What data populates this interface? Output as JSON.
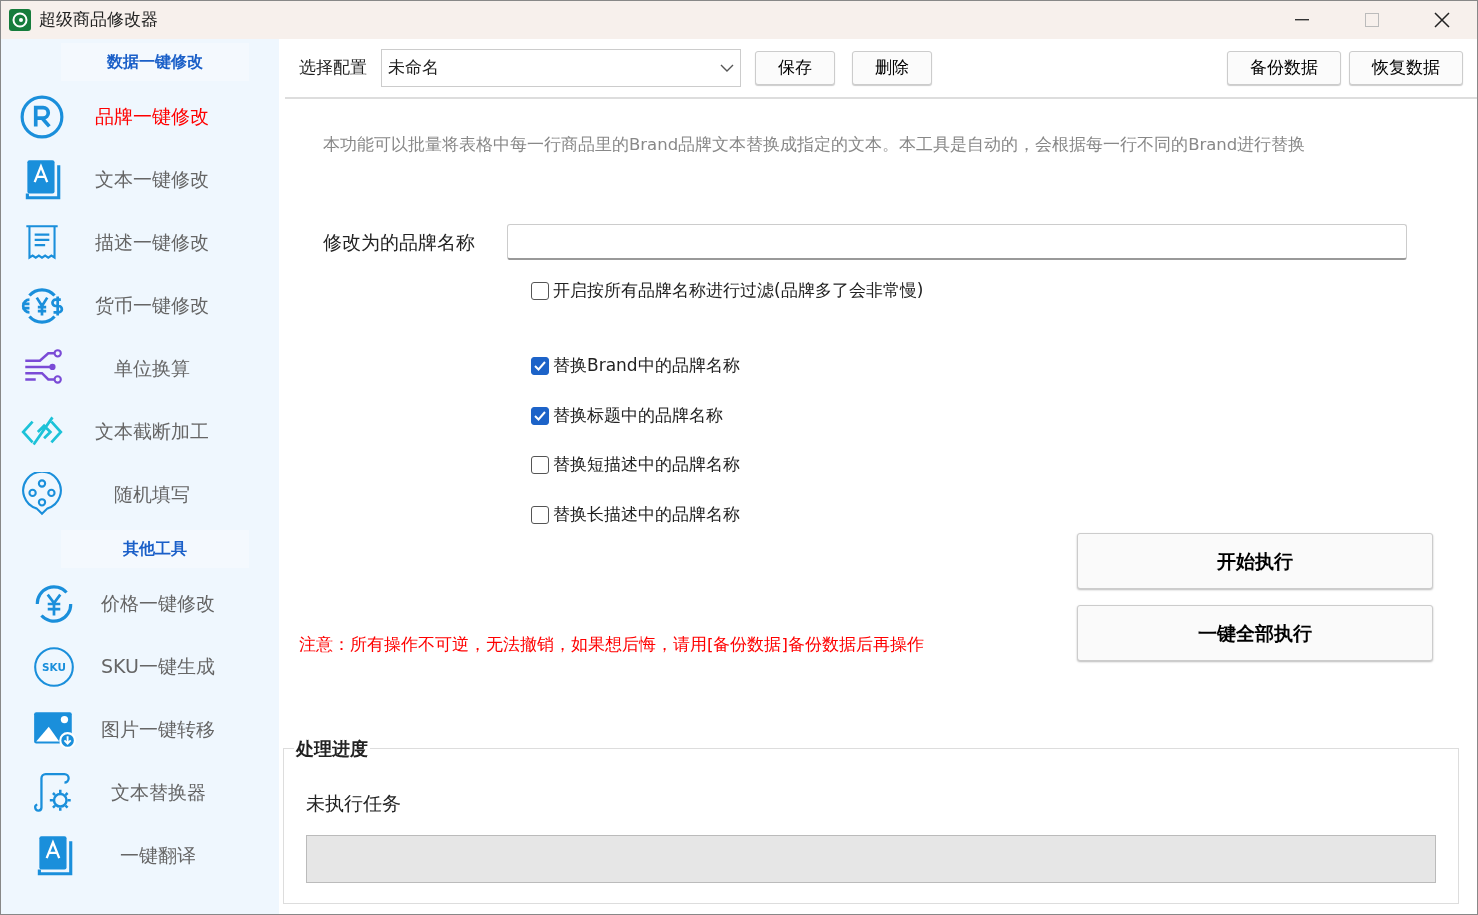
{
  "window": {
    "title": "超级商品修改器"
  },
  "sidebar": {
    "sections": [
      {
        "header": "数据一键修改",
        "items": [
          {
            "label": "品牌一键修改",
            "selected": true
          },
          {
            "label": "文本一键修改",
            "selected": false
          },
          {
            "label": "描述一键修改",
            "selected": false
          },
          {
            "label": "货币一键修改",
            "selected": false
          },
          {
            "label": "单位换算",
            "selected": false
          },
          {
            "label": "文本截断加工",
            "selected": false
          },
          {
            "label": "随机填写",
            "selected": false
          }
        ]
      },
      {
        "header": "其他工具",
        "items": [
          {
            "label": "价格一键修改",
            "selected": false
          },
          {
            "label": "SKU一键生成",
            "icon_text": "SKU",
            "selected": false
          },
          {
            "label": "图片一键转移",
            "selected": false
          },
          {
            "label": "文本替换器",
            "selected": false
          },
          {
            "label": "一键翻译",
            "selected": false
          }
        ]
      }
    ]
  },
  "toolbar": {
    "config_label": "选择配置",
    "config_value": "未命名",
    "buttons": [
      "保存",
      "删除"
    ],
    "right_buttons": [
      "备份数据",
      "恢复数据"
    ]
  },
  "description": "本功能可以批量将表格中每一行商品里的Brand品牌文本替换成指定的文本。本工具是自动的，会根据每一行不同的Brand进行替换",
  "brand_field": {
    "label": "修改为的品牌名称"
  },
  "filter_option": {
    "label": "开启按所有品牌名称进行过滤(品牌多了会非常慢)",
    "checked": false
  },
  "options": [
    {
      "label": "替换Brand中的品牌名称",
      "checked": true
    },
    {
      "label": "替换标题中的品牌名称",
      "checked": true
    },
    {
      "label": "替换短描述中的品牌名称",
      "checked": false
    },
    {
      "label": "替换长描述中的品牌名称",
      "checked": false
    }
  ],
  "actions": [
    "开始执行",
    "一键全部执行"
  ],
  "warning": "注意：所有操作不可逆，无法撤销，如果想后悔，请用[备份数据]备份数据后再操作",
  "progress": {
    "title": "处理进度",
    "status": "未执行任务",
    "level": 0
  }
}
